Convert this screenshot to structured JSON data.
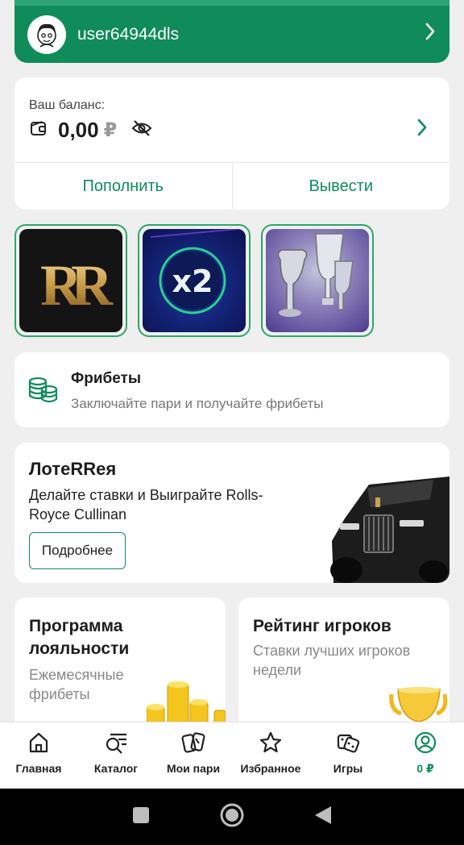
{
  "user": {
    "name": "user64944dls"
  },
  "balance": {
    "label": "Ваш баланс:",
    "amount": "0,00",
    "currency": "₽",
    "deposit_label": "Пополнить",
    "withdraw_label": "Вывести"
  },
  "stories": [
    {
      "name": "rolls-royce-story",
      "text": "RR"
    },
    {
      "name": "x2-story",
      "text": "x2"
    },
    {
      "name": "trophies-story",
      "text": ""
    }
  ],
  "freebets": {
    "title": "Фрибеты",
    "subtitle": "Заключайте пари и получайте фрибеты"
  },
  "lottery": {
    "title": "ЛотеRRея",
    "subtitle": "Делайте ставки и Выиграйте Rolls-Royce Cullinan",
    "button": "Подробнее"
  },
  "loyalty": {
    "title": "Программа лояльности",
    "subtitle": "Ежемесячные фрибеты"
  },
  "rating": {
    "title": "Рейтинг игроков",
    "subtitle": "Ставки лучших игроков недели"
  },
  "nav": {
    "items": [
      {
        "label": "Главная",
        "icon": "home-icon"
      },
      {
        "label": "Каталог",
        "icon": "catalog-icon"
      },
      {
        "label": "Мои пари",
        "icon": "my-bets-icon"
      },
      {
        "label": "Избранное",
        "icon": "star-icon"
      },
      {
        "label": "Игры",
        "icon": "dice-icon"
      },
      {
        "label": "0 ₽",
        "icon": "profile-icon"
      }
    ],
    "active_index": 5
  },
  "colors": {
    "brand": "#0f8c5a",
    "brand_light": "#2aa86b",
    "background": "#efefef"
  },
  "system_bar": {
    "icons": [
      "recents-icon",
      "home-circle-icon",
      "back-icon"
    ]
  }
}
